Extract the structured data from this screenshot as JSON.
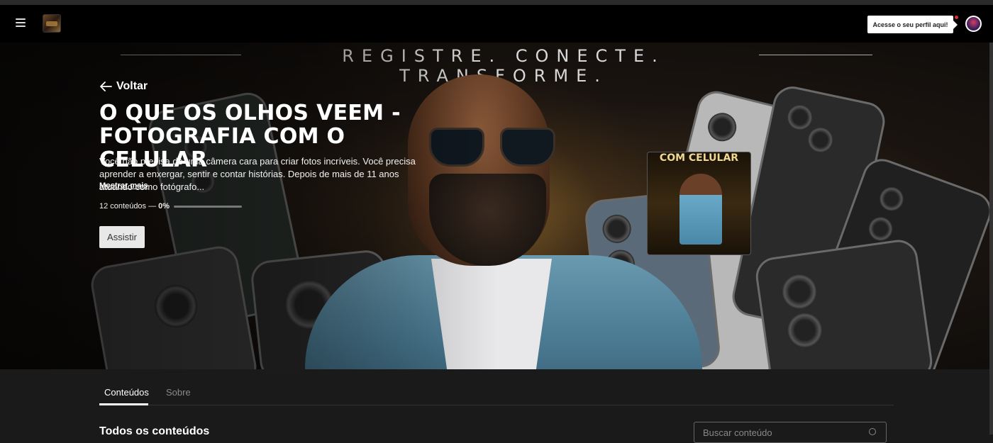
{
  "header": {
    "menu_icon": "hamburger-icon",
    "logo_icon": "brand-logo",
    "profile_tooltip": "Acesse o seu perfil aqui!",
    "notification_color": "#e03030"
  },
  "hero": {
    "tagline": "REGISTRE. CONECTE. TRANSFORME.",
    "back_label": "Voltar",
    "title": "O QUE OS OLHOS VEEM - FOTOGRAFIA COM O CELULAR",
    "description": "Você não precisa de uma câmera cara para criar fotos incríveis. Você precisa aprender a enxergar, sentir e contar histórias. Depois de mais de 11 anos atuando como fotógrafo...",
    "show_more": "Mostrar mais",
    "content_count": "12 conteúdos —",
    "progress_label": "0%",
    "progress_value": 0,
    "watch_button": "Assistir",
    "thumbnail_text": "COM CELULAR"
  },
  "tabs": [
    {
      "label": "Conteúdos",
      "active": true
    },
    {
      "label": "Sobre",
      "active": false
    }
  ],
  "contents": {
    "title": "Todos os conteúdos",
    "search_placeholder": "Buscar conteúdo"
  }
}
